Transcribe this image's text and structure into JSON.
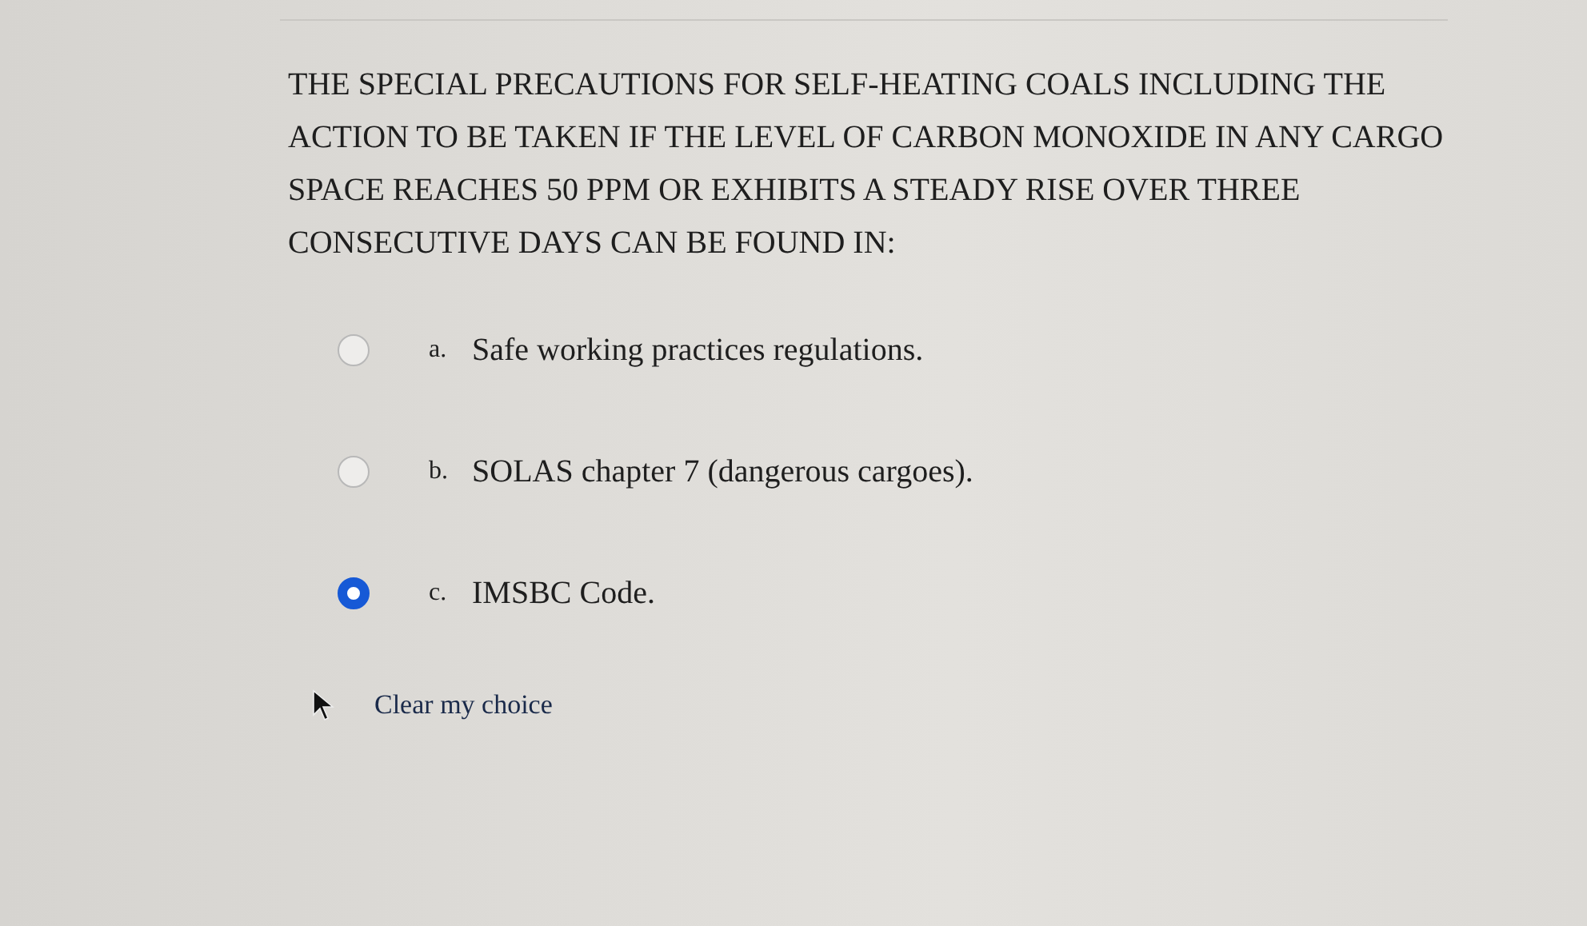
{
  "question": {
    "text": "THE SPECIAL PRECAUTIONS FOR SELF-HEATING COALS INCLUDING THE ACTION TO BE TAKEN IF THE LEVEL OF CARBON MONOXIDE IN ANY CARGO SPACE REACHES 50 PPM OR EXHIBITS A STEADY RISE OVER THREE CONSECUTIVE DAYS CAN BE FOUND IN:"
  },
  "options": [
    {
      "letter": "a.",
      "text": "Safe working practices regulations.",
      "selected": false
    },
    {
      "letter": "b.",
      "text": "SOLAS chapter 7 (dangerous cargoes).",
      "selected": false
    },
    {
      "letter": "c.",
      "text": "IMSBC Code.",
      "selected": true
    }
  ],
  "clear_link": "Clear my choice"
}
